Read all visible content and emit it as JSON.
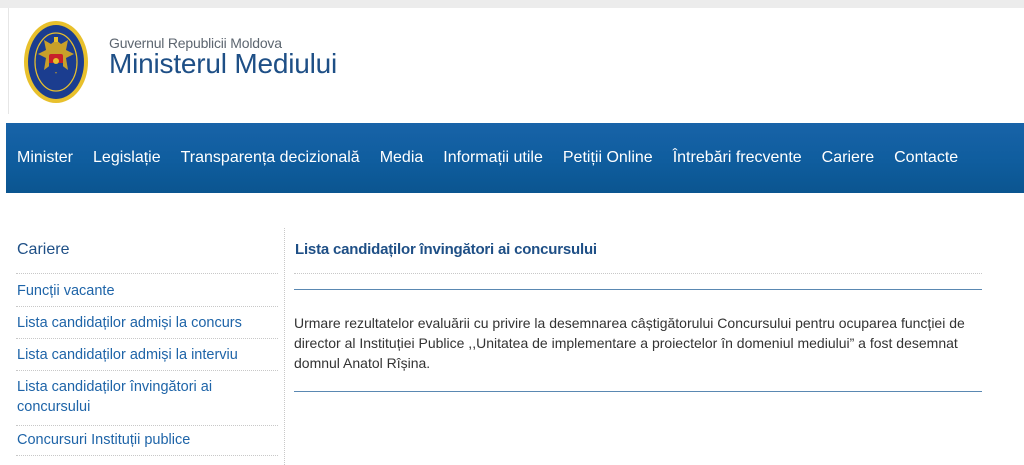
{
  "header": {
    "government": "Guvernul Republicii Moldova",
    "ministry": "Ministerul Mediului"
  },
  "nav": {
    "items": [
      "Minister",
      "Legislație",
      "Transparența decizională",
      "Media",
      "Informații utile",
      "Petiții Online",
      "Întrebări frecvente",
      "Cariere",
      "Contacte"
    ]
  },
  "sidebar": {
    "title": "Cariere",
    "items": [
      "Funcții vacante",
      "Lista candidaților admiși la concurs",
      "Lista candidaților admiși la interviu",
      "Lista candidaților învingători ai concursului",
      "Concursuri Instituții publice"
    ]
  },
  "content": {
    "title": "Lista candidaților învingători ai concursului",
    "body": " Urmare rezultatelor evaluării cu privire la desemnarea câștigătorului Concursului pentru ocuparea funcției de director al Instituției Publice ,,Unitatea de implementare a proiectelor în domeniul mediului” a fost desemnat domnul Anatol Rîșina."
  },
  "colors": {
    "nav_background": "#0f5d9e",
    "brand_blue": "#1e4f86",
    "link_blue": "#1e64a8"
  },
  "icons": {
    "logo": "moldova-coat-of-arms-icon"
  }
}
